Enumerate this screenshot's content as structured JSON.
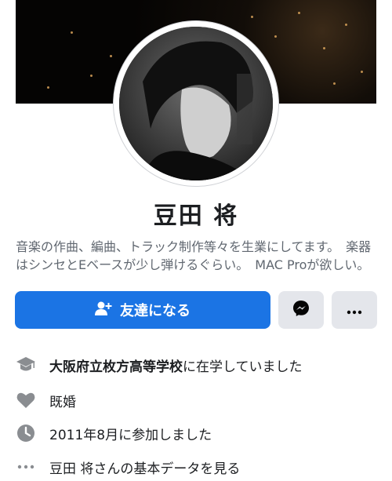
{
  "profile": {
    "name": "豆田 将",
    "bio": "音楽の作曲、編曲、トラック制作等々を生業にしてます。　楽器はシンセとEベースが少し弾けるぐらい。　MAC Proが欲しい。"
  },
  "actions": {
    "add_friend_label": "友達になる"
  },
  "details": {
    "school_name": "大阪府立枚方高等学校",
    "school_suffix": "に在学していました",
    "relationship": "既婚",
    "joined": "2011年8月に参加しました",
    "about_link": "豆田 将さんの基本データを見る"
  },
  "colors": {
    "primary": "#1b74e4",
    "icon_gray": "#8a8d91"
  }
}
